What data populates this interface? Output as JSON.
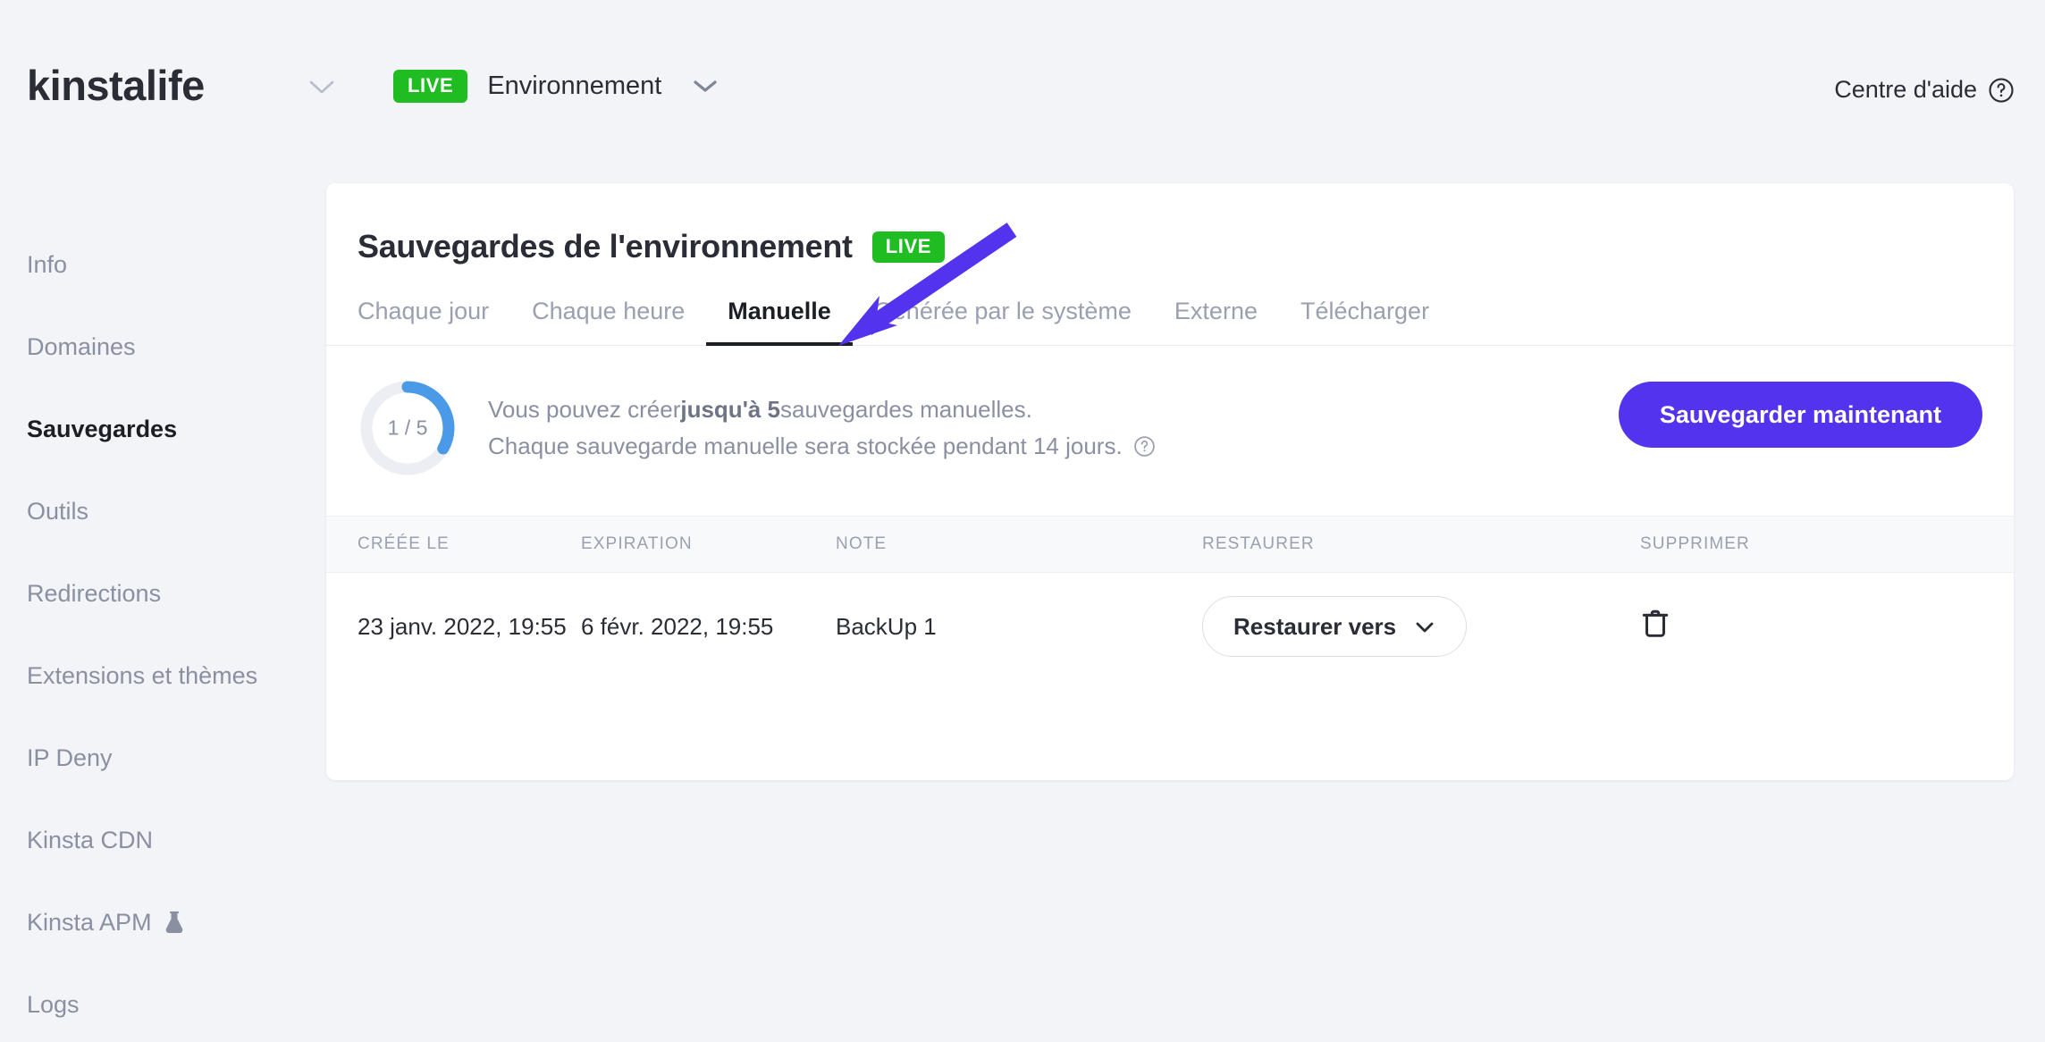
{
  "header": {
    "brand": "kinstalife",
    "brand_chevron_icon": "chevron-down-icon",
    "env_badge": "LIVE",
    "env_label": "Environnement",
    "env_chevron_icon": "chevron-down-icon",
    "help_center_label": "Centre d'aide",
    "help_center_icon": "question-circle-icon"
  },
  "sidebar": {
    "items": [
      {
        "label": "Info",
        "active": false
      },
      {
        "label": "Domaines",
        "active": false
      },
      {
        "label": "Sauvegardes",
        "active": true
      },
      {
        "label": "Outils",
        "active": false
      },
      {
        "label": "Redirections",
        "active": false
      },
      {
        "label": "Extensions et thèmes",
        "active": false
      },
      {
        "label": "IP Deny",
        "active": false
      },
      {
        "label": "Kinsta CDN",
        "active": false
      },
      {
        "label": "Kinsta APM",
        "active": false,
        "icon": "flask-icon"
      },
      {
        "label": "Logs",
        "active": false
      }
    ]
  },
  "card": {
    "title": "Sauvegardes de l'environnement",
    "title_badge": "LIVE",
    "tabs": [
      {
        "label": "Chaque jour",
        "active": false
      },
      {
        "label": "Chaque heure",
        "active": false
      },
      {
        "label": "Manuelle",
        "active": true
      },
      {
        "label": "Générée par le système",
        "active": false
      },
      {
        "label": "Externe",
        "active": false
      },
      {
        "label": "Télécharger",
        "active": false
      }
    ],
    "quota": {
      "used": 1,
      "total": 5,
      "display": "1 / 5",
      "ring_color": "#4a9ae8",
      "track_color": "#eceef4"
    },
    "info_line_1_pre": "Vous pouvez créer ",
    "info_line_1_strong": "jusqu'à 5",
    "info_line_1_post": " sauvegardes manuelles.",
    "info_line_2": "Chaque sauvegarde manuelle sera stockée pendant 14 jours.",
    "info_help_icon": "question-circle-icon",
    "primary_button": "Sauvegarder maintenant",
    "primary_button_color": "#5333ed"
  },
  "table": {
    "columns": [
      "CRÉÉE LE",
      "EXPIRATION",
      "NOTE",
      "RESTAURER",
      "SUPPRIMER"
    ],
    "rows": [
      {
        "created": "23 janv. 2022, 19:55",
        "expiration": "6 févr. 2022, 19:55",
        "note": "BackUp 1",
        "restore_label": "Restaurer vers",
        "restore_chevron_icon": "chevron-down-icon",
        "delete_icon": "trash-icon"
      }
    ]
  },
  "annotation": {
    "type": "arrow",
    "color": "#5333ed",
    "points_to": "Manuelle"
  }
}
